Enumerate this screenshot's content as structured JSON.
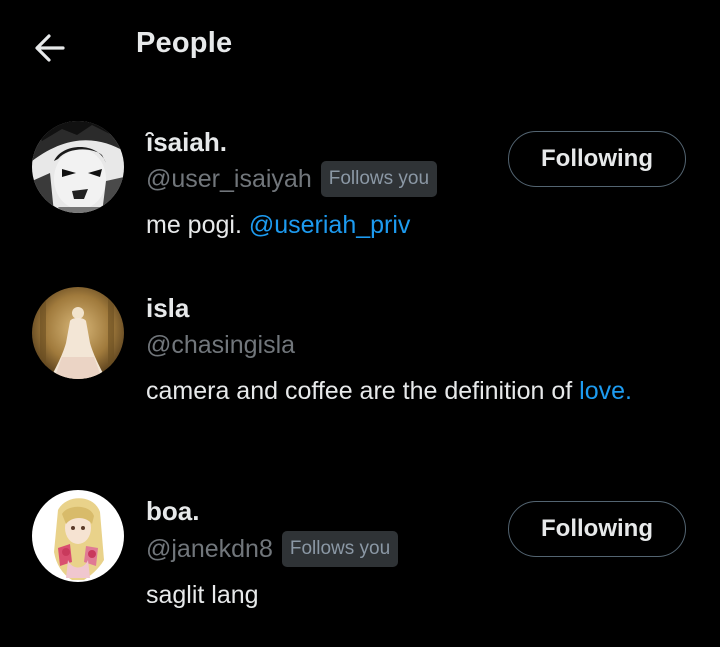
{
  "header": {
    "title": "People",
    "back_icon": "arrow-left-icon"
  },
  "people": [
    {
      "name": "ȋsaiah.",
      "handle": "@user_isaiyah",
      "follows_you": "Follows you",
      "bio_text": "me pogi. ",
      "bio_mention": "@useriah_priv",
      "button_label": "Following",
      "avatar": "manga-character-avatar"
    },
    {
      "name": "isla",
      "handle": "@chasingisla",
      "bio_text": "camera and coffee are the definition of ",
      "bio_link": "love.",
      "avatar": "gown-woman-avatar"
    },
    {
      "name": "boa.",
      "handle": "@janekdn8",
      "follows_you": "Follows you",
      "bio_text": "saglit lang",
      "button_label": "Following",
      "avatar": "blonde-girl-avatar"
    }
  ],
  "colors": {
    "background": "#000000",
    "primary_text": "#e7e9ea",
    "secondary_text": "#71767b",
    "link": "#1d9bf0",
    "badge_bg": "#2f3336",
    "button_border": "#536471"
  }
}
